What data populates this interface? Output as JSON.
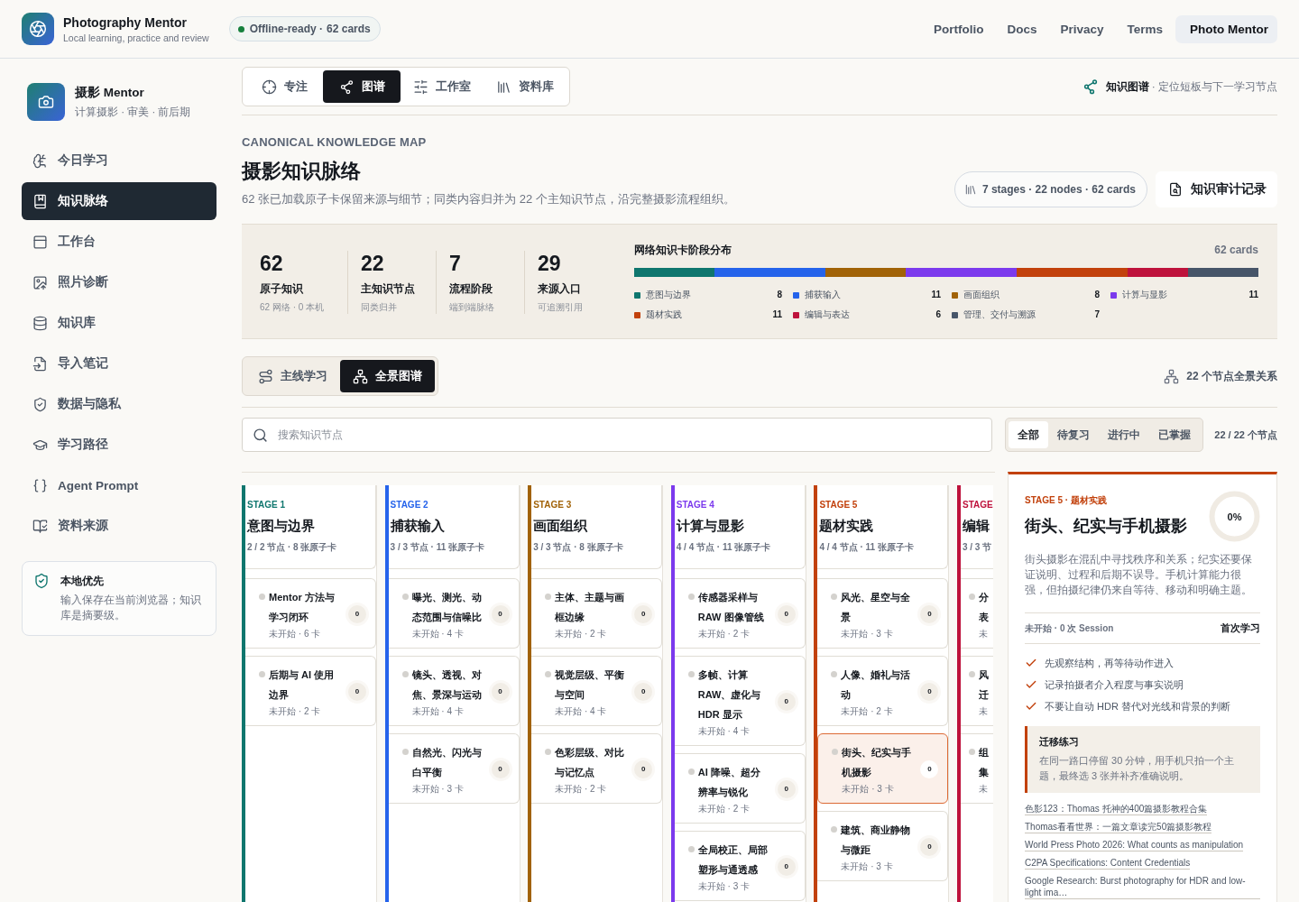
{
  "header": {
    "app_title": "Photography Mentor",
    "app_subtitle": "Local learning, practice and review",
    "status_badge": {
      "status": "Offline-ready ·",
      "count": "62 cards"
    },
    "nav": [
      {
        "label": "Portfolio",
        "selected": false
      },
      {
        "label": "Docs",
        "selected": false
      },
      {
        "label": "Privacy",
        "selected": false
      },
      {
        "label": "Terms",
        "selected": false
      },
      {
        "label": "Photo Mentor",
        "selected": true
      }
    ]
  },
  "sidebar": {
    "profile": {
      "title": "摄影 Mentor",
      "subtitle": "计算摄影 · 审美 · 前后期"
    },
    "items": [
      {
        "label": "今日学习",
        "selected": false
      },
      {
        "label": "知识脉络",
        "selected": true
      },
      {
        "label": "工作台",
        "selected": false
      },
      {
        "label": "照片诊断",
        "selected": false
      },
      {
        "label": "知识库",
        "selected": false
      },
      {
        "label": "导入笔记",
        "selected": false
      },
      {
        "label": "数据与隐私",
        "selected": false
      },
      {
        "label": "学习路径",
        "selected": false
      },
      {
        "label": "Agent Prompt",
        "selected": false
      },
      {
        "label": "资料来源",
        "selected": false
      }
    ],
    "notice": {
      "title": "本地优先",
      "text": "输入保存在当前浏览器；知识库是摘要级。"
    }
  },
  "main": {
    "mode_tabs": [
      {
        "label": "专注",
        "selected": false
      },
      {
        "label": "图谱",
        "selected": true
      },
      {
        "label": "工作室",
        "selected": false
      },
      {
        "label": "资料库",
        "selected": false
      }
    ],
    "context": {
      "title": "知识图谱",
      "text": "· 定位短板与下一学习节点"
    },
    "eyebrow": "CANONICAL KNOWLEDGE MAP",
    "title": "摄影知识脉络",
    "description": "62 张已加载原子卡保留来源与细节；同类内容归并为 22 个主知识节点，沿完整摄影流程组织。",
    "summary_pill": "7 stages · 22 nodes · 62 cards",
    "audit_button": "知识审计记录",
    "stats": [
      {
        "value": "62",
        "label": "原子知识",
        "note": "62 网络 · 0 本机"
      },
      {
        "value": "22",
        "label": "主知识节点",
        "note": "同类归并"
      },
      {
        "value": "7",
        "label": "流程阶段",
        "note": "端到端脉络"
      },
      {
        "value": "29",
        "label": "来源入口",
        "note": "可追溯引用"
      }
    ],
    "distribution": {
      "title": "网络知识卡阶段分布",
      "total": "62 cards",
      "segments": [
        {
          "name": "意图与边界",
          "count": "8",
          "color": "#0f766e"
        },
        {
          "name": "捕获输入",
          "count": "11",
          "color": "#2563eb"
        },
        {
          "name": "画面组织",
          "count": "8",
          "color": "#a16207"
        },
        {
          "name": "计算与显影",
          "count": "11",
          "color": "#7c3aed"
        },
        {
          "name": "题材实践",
          "count": "11",
          "color": "#c2410c"
        },
        {
          "name": "编辑与表达",
          "count": "6",
          "color": "#be123c"
        },
        {
          "name": "管理、交付与溯源",
          "count": "7",
          "color": "#475569"
        }
      ]
    },
    "view_tabs": [
      {
        "label": "主线学习",
        "selected": false
      },
      {
        "label": "全景图谱",
        "selected": true
      }
    ],
    "overview_label": "22 个节点全景关系",
    "search": {
      "placeholder": "搜索知识节点"
    },
    "filters": [
      {
        "label": "全部",
        "selected": true
      },
      {
        "label": "待复习",
        "selected": false
      },
      {
        "label": "进行中",
        "selected": false
      },
      {
        "label": "已掌握",
        "selected": false
      }
    ],
    "filter_count": "22 / 22 个节点",
    "stages": [
      {
        "kind": "full",
        "label": "STAGE 1",
        "title": "意图与边界",
        "meta": "2 / 2 节点 · 8 张原子卡",
        "color": "#0f766e",
        "nodes": [
          {
            "title": "Mentor 方法与学习闭环",
            "meta": "未开始 · 6 卡",
            "count": "0",
            "selected": false
          },
          {
            "title": "后期与 AI 使用边界",
            "meta": "未开始 · 2 卡",
            "count": "0",
            "selected": false
          }
        ]
      },
      {
        "kind": "full",
        "label": "STAGE 2",
        "title": "捕获输入",
        "meta": "3 / 3 节点 · 11 张原子卡",
        "color": "#2563eb",
        "nodes": [
          {
            "title": "曝光、测光、动态范围与信噪比",
            "meta": "未开始 · 4 卡",
            "count": "0",
            "selected": false
          },
          {
            "title": "镜头、透视、对焦、景深与运动",
            "meta": "未开始 · 4 卡",
            "count": "0",
            "selected": false
          },
          {
            "title": "自然光、闪光与白平衡",
            "meta": "未开始 · 3 卡",
            "count": "0",
            "selected": false
          }
        ]
      },
      {
        "kind": "full",
        "label": "STAGE 3",
        "title": "画面组织",
        "meta": "3 / 3 节点 · 8 张原子卡",
        "color": "#a16207",
        "nodes": [
          {
            "title": "主体、主题与画框边缘",
            "meta": "未开始 · 2 卡",
            "count": "0",
            "selected": false
          },
          {
            "title": "视觉层级、平衡与空间",
            "meta": "未开始 · 4 卡",
            "count": "0",
            "selected": false
          },
          {
            "title": "色彩层级、对比与记忆点",
            "meta": "未开始 · 2 卡",
            "count": "0",
            "selected": false
          }
        ]
      },
      {
        "kind": "full",
        "label": "STAGE 4",
        "title": "计算与显影",
        "meta": "4 / 4 节点 · 11 张原子卡",
        "color": "#7c3aed",
        "nodes": [
          {
            "title": "传感器采样与 RAW 图像管线",
            "meta": "未开始 · 2 卡",
            "count": "0",
            "selected": false
          },
          {
            "title": "多帧、计算 RAW、虚化与 HDR 显示",
            "meta": "未开始 · 4 卡",
            "count": "0",
            "selected": false
          },
          {
            "title": "AI 降噪、超分辨率与锐化",
            "meta": "未开始 · 2 卡",
            "count": "0",
            "selected": false
          },
          {
            "title": "全局校正、局部塑形与通透感",
            "meta": "未开始 · 3 卡",
            "count": "0",
            "selected": false
          }
        ]
      },
      {
        "kind": "full",
        "label": "STAGE 5",
        "title": "题材实践",
        "meta": "4 / 4 节点 · 11 张原子卡",
        "color": "#c2410c",
        "nodes": [
          {
            "title": "风光、星空与全景",
            "meta": "未开始 · 3 卡",
            "count": "0",
            "selected": false
          },
          {
            "title": "人像、婚礼与活动",
            "meta": "未开始 · 2 卡",
            "count": "0",
            "selected": false
          },
          {
            "title": "街头、纪实与手机摄影",
            "meta": "未开始 · 3 卡",
            "count": "0",
            "selected": true
          },
          {
            "title": "建筑、商业静物与微距",
            "meta": "未开始 · 3 卡",
            "count": "0",
            "selected": false
          }
        ]
      },
      {
        "kind": "clipped",
        "label": "STAGE",
        "title": "编辑",
        "meta": "3 / 3 节",
        "color": "#be123c",
        "nodes": [
          {
            "title": "分表",
            "meta": "未",
            "selected": false
          },
          {
            "title": "风迁",
            "meta": "未",
            "selected": false
          },
          {
            "title": "组集",
            "meta": "未",
            "selected": false
          }
        ]
      }
    ],
    "detail": {
      "eyebrow": "STAGE 5 · 题材实践",
      "title": "街头、纪实与手机摄影",
      "progress": {
        "label": "0%"
      },
      "description": "街头摄影在混乱中寻找秩序和关系；纪实还要保证说明、过程和后期不误导。手机计算能力很强，但拍摄纪律仍来自等待、移动和明确主题。",
      "status": "未开始 · 0 次 Session",
      "next_step": "首次学习",
      "checklist": [
        "先观察结构，再等待动作进入",
        "记录拍摄者介入程度与事实说明",
        "不要让自动 HDR 替代对光线和背景的判断"
      ],
      "exercise": {
        "title": "迁移练习",
        "text": "在同一路口停留 30 分钟，用手机只拍一个主题，最终选 3 张并补齐准确说明。"
      },
      "sources": [
        "色影123：Thomas 托神的400篇摄影教程合集",
        "Thomas看看世界：一篇文章读完50篇摄影教程",
        "World Press Photo 2026: What counts as manipulation",
        "C2PA Specifications: Content Credentials",
        "Google Research: Burst photography for HDR and low-light ima…"
      ]
    }
  }
}
